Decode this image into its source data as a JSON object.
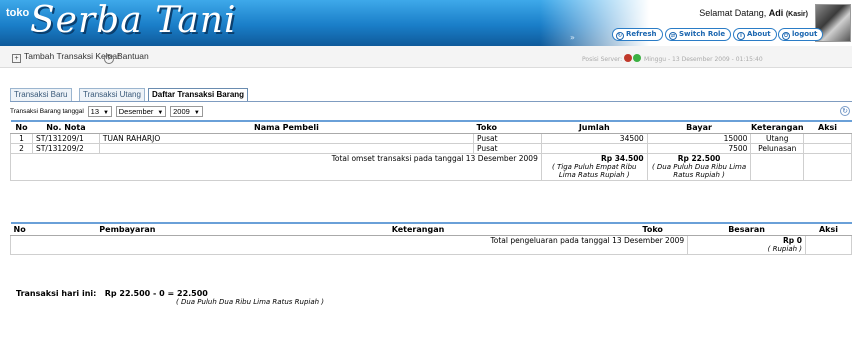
{
  "app": {
    "logo_prefix": "toko",
    "logo_name": "Serba Tani"
  },
  "header": {
    "greeting_prefix": "Selamat Datang,",
    "user": "Adi",
    "role": "(Kasir)",
    "buttons": {
      "refresh": "Refresh",
      "switch_role": "Switch Role",
      "about": "About",
      "logout": "logout"
    },
    "marker": "»"
  },
  "subbar": {
    "tambah": "Tambah Transaksi Keluar",
    "bantuan": "Bantuan",
    "server_label": "Posisi Server:",
    "server_date": "Minggu - 13 Desember 2009 - 01:15:40",
    "colors": {
      "red": "#c0392b",
      "green": "#3cb043"
    }
  },
  "tabs": [
    "Transaksi Baru",
    "Transaksi Utang",
    "Daftar Transaksi Barang"
  ],
  "filter": {
    "label": "Transaksi Barang tanggal",
    "day": "13",
    "month": "Desember",
    "year": "2009"
  },
  "sales_table": {
    "headers": [
      "No",
      "No. Nota",
      "Nama Pembeli",
      "Toko",
      "Jumlah",
      "Bayar",
      "Keterangan",
      "Aksi"
    ],
    "rows": [
      {
        "no": "1",
        "nota": "ST/131209/1",
        "pembeli": "TUAN RAHARJO",
        "toko": "Pusat",
        "jumlah": "34500",
        "bayar": "15000",
        "ket": "Utang"
      },
      {
        "no": "2",
        "nota": "ST/131209/2",
        "pembeli": "",
        "toko": "Pusat",
        "jumlah": "",
        "bayar": "7500",
        "ket": "Pelunasan"
      }
    ],
    "total_label": "Total omset transaksi pada tanggal 13 Desember 2009",
    "total_jumlah": "Rp 34.500",
    "total_jumlah_words": "( Tiga Puluh Empat Ribu Lima Ratus Rupiah )",
    "total_bayar": "Rp 22.500",
    "total_bayar_words": "( Dua Puluh Dua Ribu Lima Ratus Rupiah )"
  },
  "expense_table": {
    "headers": [
      "No",
      "Pembayaran",
      "Keterangan",
      "Toko",
      "Besaran",
      "Aksi"
    ],
    "total_label": "Total pengeluaran pada tanggal 13 Desember 2009",
    "total_value": "Rp 0",
    "total_words": "( Rupiah )"
  },
  "summary": {
    "label": "Transaksi hari ini:",
    "formula": "Rp 22.500 - 0 =",
    "result": "22.500",
    "words": "( Dua Puluh Dua Ribu Lima Ratus Rupiah )"
  }
}
